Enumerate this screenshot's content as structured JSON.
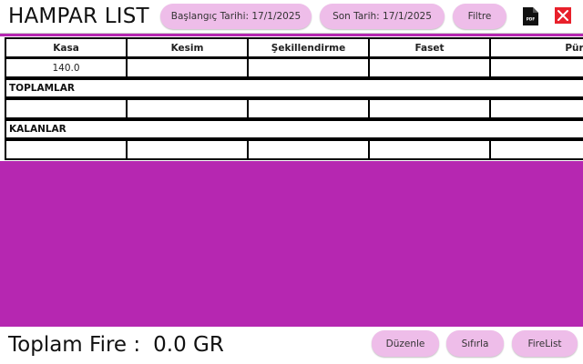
{
  "header": {
    "title": "HAMPAR LIST",
    "start_date_label": "Başlangıç Tarihi: 17/1/2025",
    "end_date_label": "Son Tarih: 17/1/2025",
    "filter_label": "Filtre",
    "pdf_icon_text": "PDF",
    "icons": [
      "pdf-icon",
      "close-icon"
    ]
  },
  "table": {
    "columns": [
      "Kasa",
      "Kesim",
      "Şekillendirme",
      "Faset",
      "Pürüzcü"
    ],
    "rows": [
      [
        "140.0",
        "",
        "",
        "",
        ""
      ]
    ],
    "totals_label": "TOPLAMLAR",
    "totals_row": [
      "",
      "",
      "",
      "",
      ""
    ],
    "remaining_label": "KALANLAR",
    "remaining_row": [
      "",
      "",
      "",
      "",
      ""
    ]
  },
  "footer": {
    "total_fire_label": "Toplam Fire :",
    "total_fire_value": "0.0 GR",
    "edit_label": "Düzenle",
    "reset_label": "Sıfırla",
    "firelist_label": "FireList"
  },
  "colors": {
    "background": "#b627b1",
    "pill": "#eebde9",
    "close": "#e8202b"
  }
}
